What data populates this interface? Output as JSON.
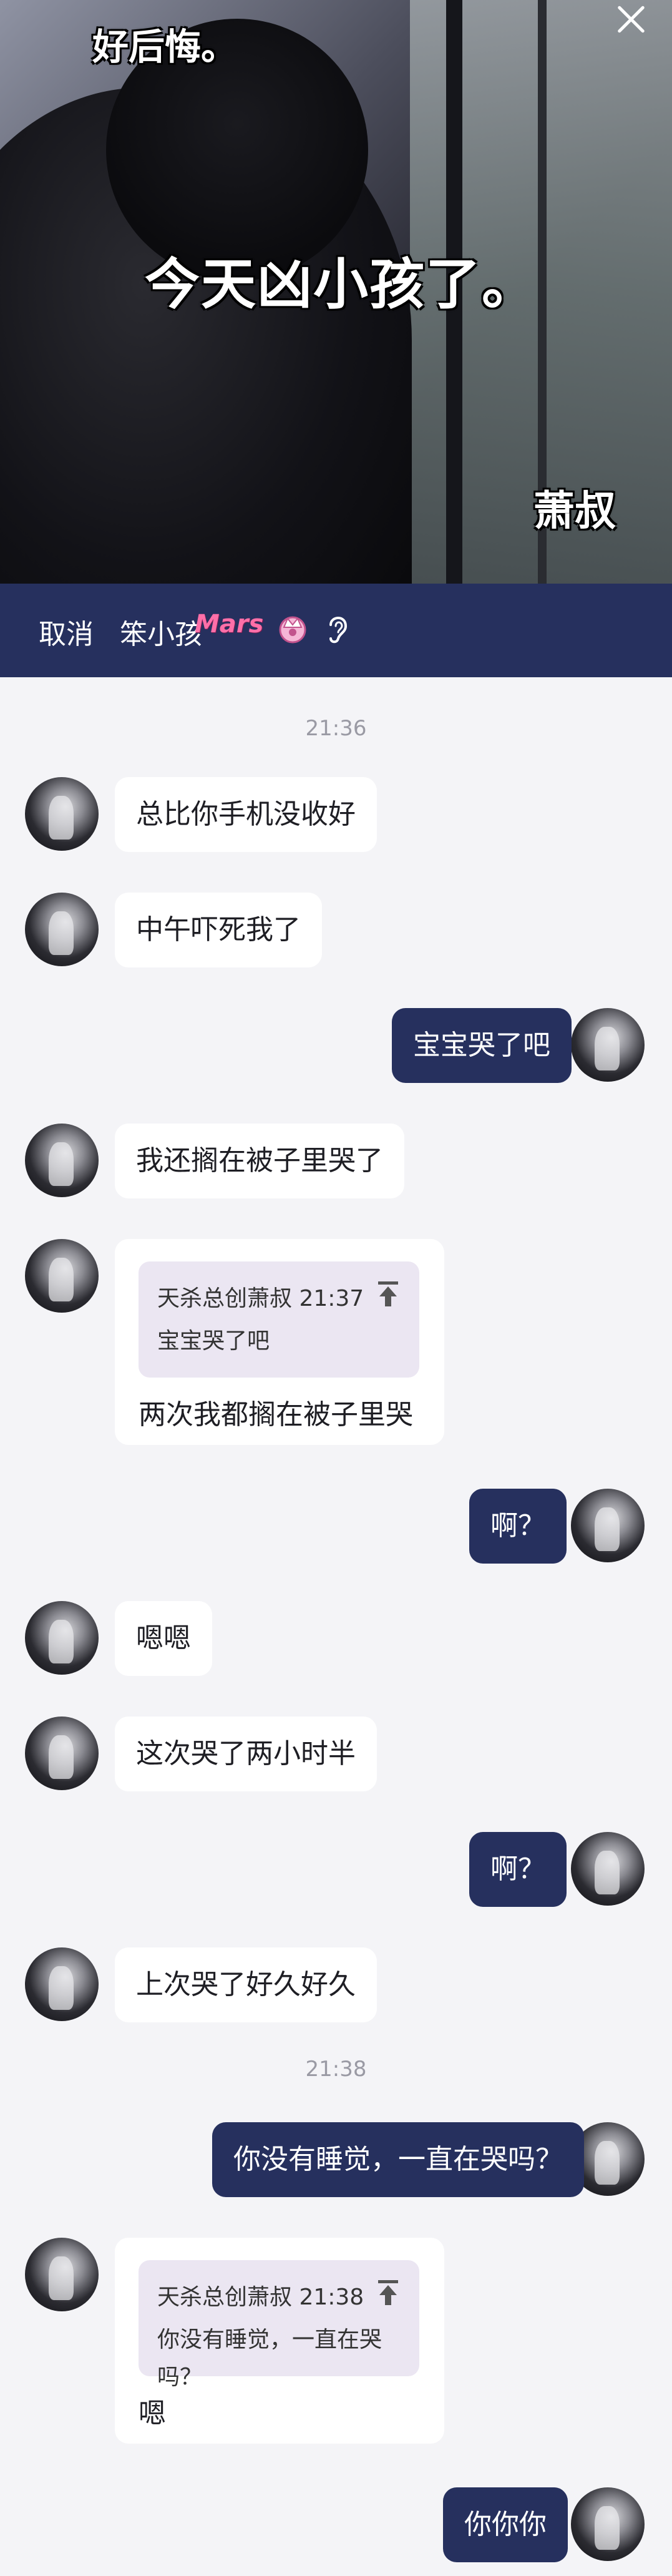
{
  "banner": {
    "caption_top": "好后悔。",
    "caption_mid": "今天凶小孩了。",
    "caption_sign": "萧叔"
  },
  "header": {
    "cancel": "取消",
    "title": "笨小孩",
    "badge": "Mars"
  },
  "messages": [
    {
      "time": "21:36"
    },
    {
      "side": "in",
      "text": "总比你手机没收好"
    },
    {
      "side": "in",
      "text": "中午吓死我了"
    },
    {
      "side": "out",
      "text": "宝宝哭了吧"
    },
    {
      "side": "in",
      "text": "我还搁在被子里哭了"
    },
    {
      "side": "in",
      "quote_head": "天杀总创萧叔 21:37",
      "quote_text": "宝宝哭了吧",
      "text": "两次我都搁在被子里哭"
    },
    {
      "side": "out",
      "text": "啊？"
    },
    {
      "side": "in",
      "text": "嗯嗯"
    },
    {
      "side": "in",
      "text": "这次哭了两小时半"
    },
    {
      "side": "out",
      "text": "啊？"
    },
    {
      "side": "in",
      "text": "上次哭了好久好久"
    },
    {
      "time": "21:38"
    },
    {
      "side": "out",
      "text": "你没有睡觉，一直在哭吗？"
    },
    {
      "side": "in",
      "quote_head": "天杀总创萧叔 21:38",
      "quote_text": "你没有睡觉，一直在哭吗？",
      "text": "嗯"
    },
    {
      "side": "out",
      "text": "你你你"
    }
  ],
  "colors": {
    "accent": "#26305e",
    "chat_bg": "#f4f4f7"
  }
}
